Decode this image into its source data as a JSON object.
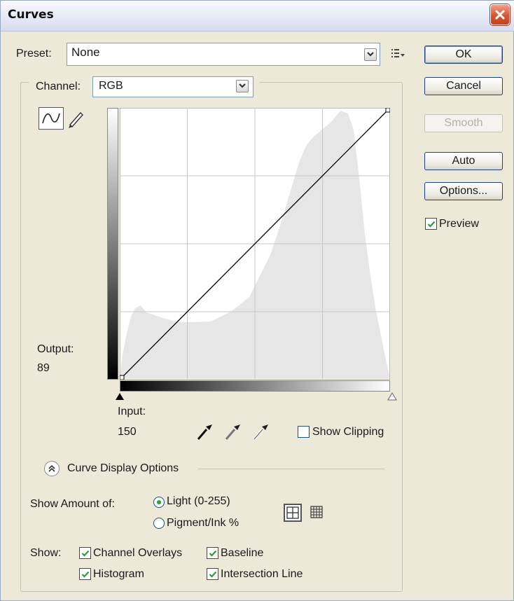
{
  "dialog": {
    "title": "Curves"
  },
  "preset": {
    "label": "Preset:",
    "value": "None"
  },
  "channel": {
    "label": "Channel:",
    "value": "RGB"
  },
  "buttons": {
    "ok": "OK",
    "cancel": "Cancel",
    "smooth": "Smooth",
    "auto": "Auto",
    "options": "Options..."
  },
  "preview": {
    "label": "Preview",
    "checked": true
  },
  "output": {
    "label": "Output:",
    "value": "89"
  },
  "input": {
    "label": "Input:",
    "value": "150"
  },
  "show_clipping": {
    "label": "Show Clipping",
    "checked": false
  },
  "curve_display": {
    "label": "Curve Display Options"
  },
  "show_amount": {
    "label": "Show Amount of:",
    "options": [
      {
        "label": "Light  (0-255)",
        "selected": true
      },
      {
        "label": "Pigment/Ink %",
        "selected": false
      }
    ]
  },
  "show": {
    "label": "Show:",
    "items": [
      {
        "label": "Channel Overlays",
        "checked": true
      },
      {
        "label": "Baseline",
        "checked": true
      },
      {
        "label": "Histogram",
        "checked": true
      },
      {
        "label": "Intersection Line",
        "checked": true
      }
    ]
  },
  "icons": {
    "close": "close-icon",
    "preset_menu": "preset-options-icon",
    "curve_tool": "curve-point-tool-icon",
    "pencil_tool": "pencil-tool-icon",
    "eyedroppers": [
      "black-point-eyedropper-icon",
      "gray-point-eyedropper-icon",
      "white-point-eyedropper-icon"
    ],
    "grid_simple": "simple-grid-icon",
    "grid_detailed": "detailed-grid-icon"
  },
  "colors": {
    "dialog_bg": "#ece9d8",
    "histogram": "#e6e6e6",
    "check": "#23a33a",
    "close": "#d65532"
  }
}
